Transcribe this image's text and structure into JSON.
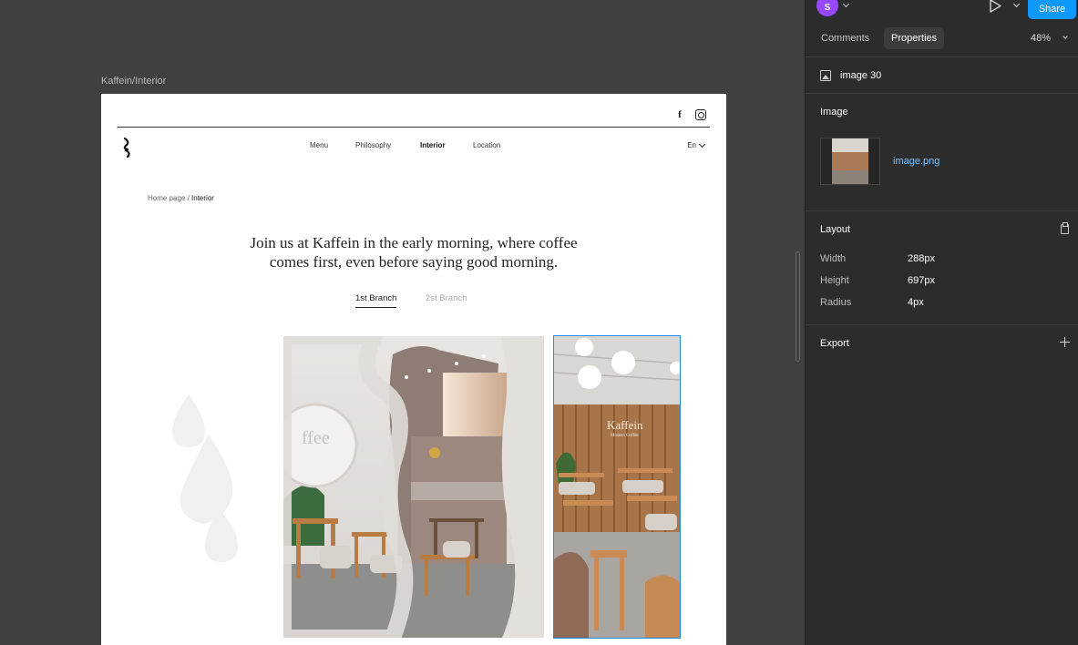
{
  "canvas": {
    "frame_label": "Kaffein/Interior"
  },
  "site": {
    "social": {
      "facebook_label": "f",
      "facebook_icon": "facebook-icon",
      "instagram_icon": "instagram-icon"
    },
    "nav": [
      "Menu",
      "Philosophy",
      "Interior",
      "Location"
    ],
    "active_nav": "Interior",
    "language": "En",
    "breadcrumb": {
      "home": "Home page",
      "separator": " / ",
      "current": "Interior"
    },
    "headline_line1": "Join us at Kaffein in the early morning, where coffee",
    "headline_line2": "comes first, even before saying good morning.",
    "branches": [
      "1st Branch",
      "2st Branch"
    ],
    "active_branch": "1st Branch",
    "sign": {
      "brand": "Kaffein",
      "subtitle": "Modern Coffee"
    },
    "mirror_text": "ffee"
  },
  "panel": {
    "avatar_initial": "S",
    "share_label": "Share",
    "tabs": [
      "Comments",
      "Properties"
    ],
    "active_tab": "Properties",
    "zoom": "48%",
    "selection_name": "image 30",
    "image_section_title": "Image",
    "image_file": "image.png",
    "layout_title": "Layout",
    "layout": [
      {
        "label": "Width",
        "value": "288px"
      },
      {
        "label": "Height",
        "value": "697px"
      },
      {
        "label": "Radius",
        "value": "4px"
      }
    ],
    "export_title": "Export"
  },
  "colors": {
    "accent": "#0d99ff",
    "avatar": "#9747ff",
    "selection": "#1d8ce8",
    "link": "#7cc4ff"
  }
}
